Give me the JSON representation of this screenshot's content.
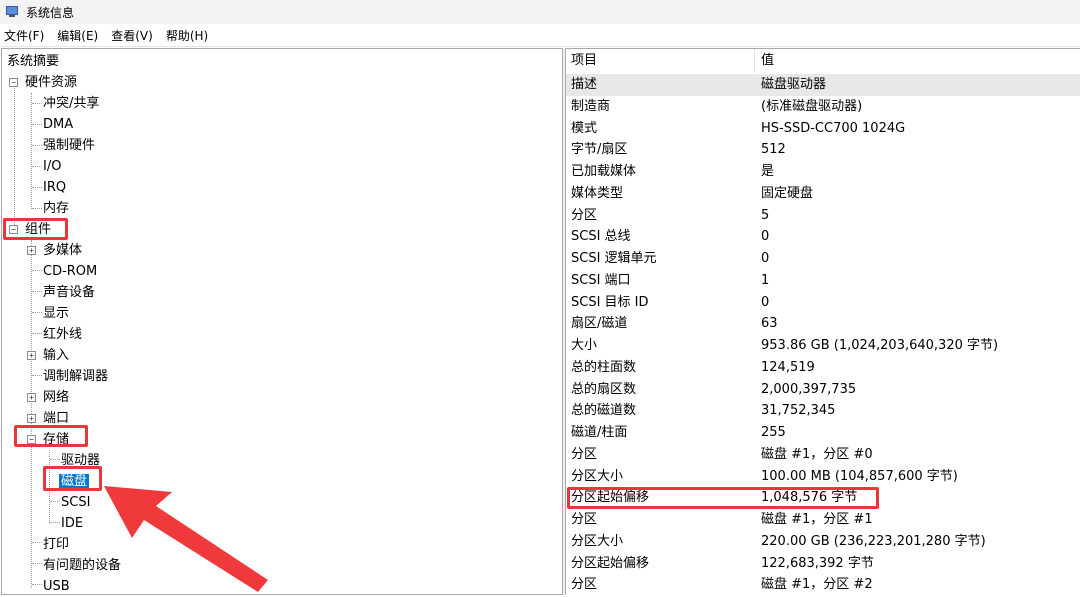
{
  "window": {
    "title": "系统信息"
  },
  "menu": [
    "文件(F)",
    "编辑(E)",
    "查看(V)",
    "帮助(H)"
  ],
  "tree": {
    "root": "系统摘要",
    "hardware": {
      "label": "硬件资源",
      "children": [
        "冲突/共享",
        "DMA",
        "强制硬件",
        "I/O",
        "IRQ",
        "内存"
      ]
    },
    "components": {
      "label": "组件",
      "items": {
        "multimedia": "多媒体",
        "cdrom": "CD-ROM",
        "sound": "声音设备",
        "display": "显示",
        "infrared": "红外线",
        "input": "输入",
        "modem": "调制解调器",
        "network": "网络",
        "ports": "端口",
        "storage": "存储",
        "drives": "驱动器",
        "disks": "磁盘",
        "scsi": "SCSI",
        "ide": "IDE",
        "printing": "打印",
        "problem_devices": "有问题的设备",
        "usb": "USB"
      }
    }
  },
  "details": {
    "headers": {
      "item": "项目",
      "value": "值"
    },
    "rows": [
      {
        "item": "描述",
        "value": "磁盘驱动器"
      },
      {
        "item": "制造商",
        "value": "(标准磁盘驱动器)"
      },
      {
        "item": "模式",
        "value": "HS-SSD-CC700 1024G"
      },
      {
        "item": "字节/扇区",
        "value": "512"
      },
      {
        "item": "已加载媒体",
        "value": "是"
      },
      {
        "item": "媒体类型",
        "value": "固定硬盘"
      },
      {
        "item": "分区",
        "value": "5"
      },
      {
        "item": "SCSI 总线",
        "value": "0"
      },
      {
        "item": "SCSI 逻辑单元",
        "value": "0"
      },
      {
        "item": "SCSI 端口",
        "value": "1"
      },
      {
        "item": "SCSI 目标 ID",
        "value": "0"
      },
      {
        "item": "扇区/磁道",
        "value": "63"
      },
      {
        "item": "大小",
        "value": "953.86 GB (1,024,203,640,320 字节)"
      },
      {
        "item": "总的柱面数",
        "value": "124,519"
      },
      {
        "item": "总的扇区数",
        "value": "2,000,397,735"
      },
      {
        "item": "总的磁道数",
        "value": "31,752,345"
      },
      {
        "item": "磁道/柱面",
        "value": "255"
      },
      {
        "item": "分区",
        "value": "磁盘 #1，分区 #0"
      },
      {
        "item": "分区大小",
        "value": "100.00 MB (104,857,600 字节)"
      },
      {
        "item": "分区起始偏移",
        "value": "1,048,576 字节"
      },
      {
        "item": "分区",
        "value": "磁盘 #1，分区 #1"
      },
      {
        "item": "分区大小",
        "value": "220.00 GB (236,223,201,280 字节)"
      },
      {
        "item": "分区起始偏移",
        "value": "122,683,392 字节"
      },
      {
        "item": "分区",
        "value": "磁盘 #1，分区 #2"
      }
    ]
  },
  "annotations": {
    "highlight_color": "#e8363a",
    "selection_color": "#0078d7"
  }
}
